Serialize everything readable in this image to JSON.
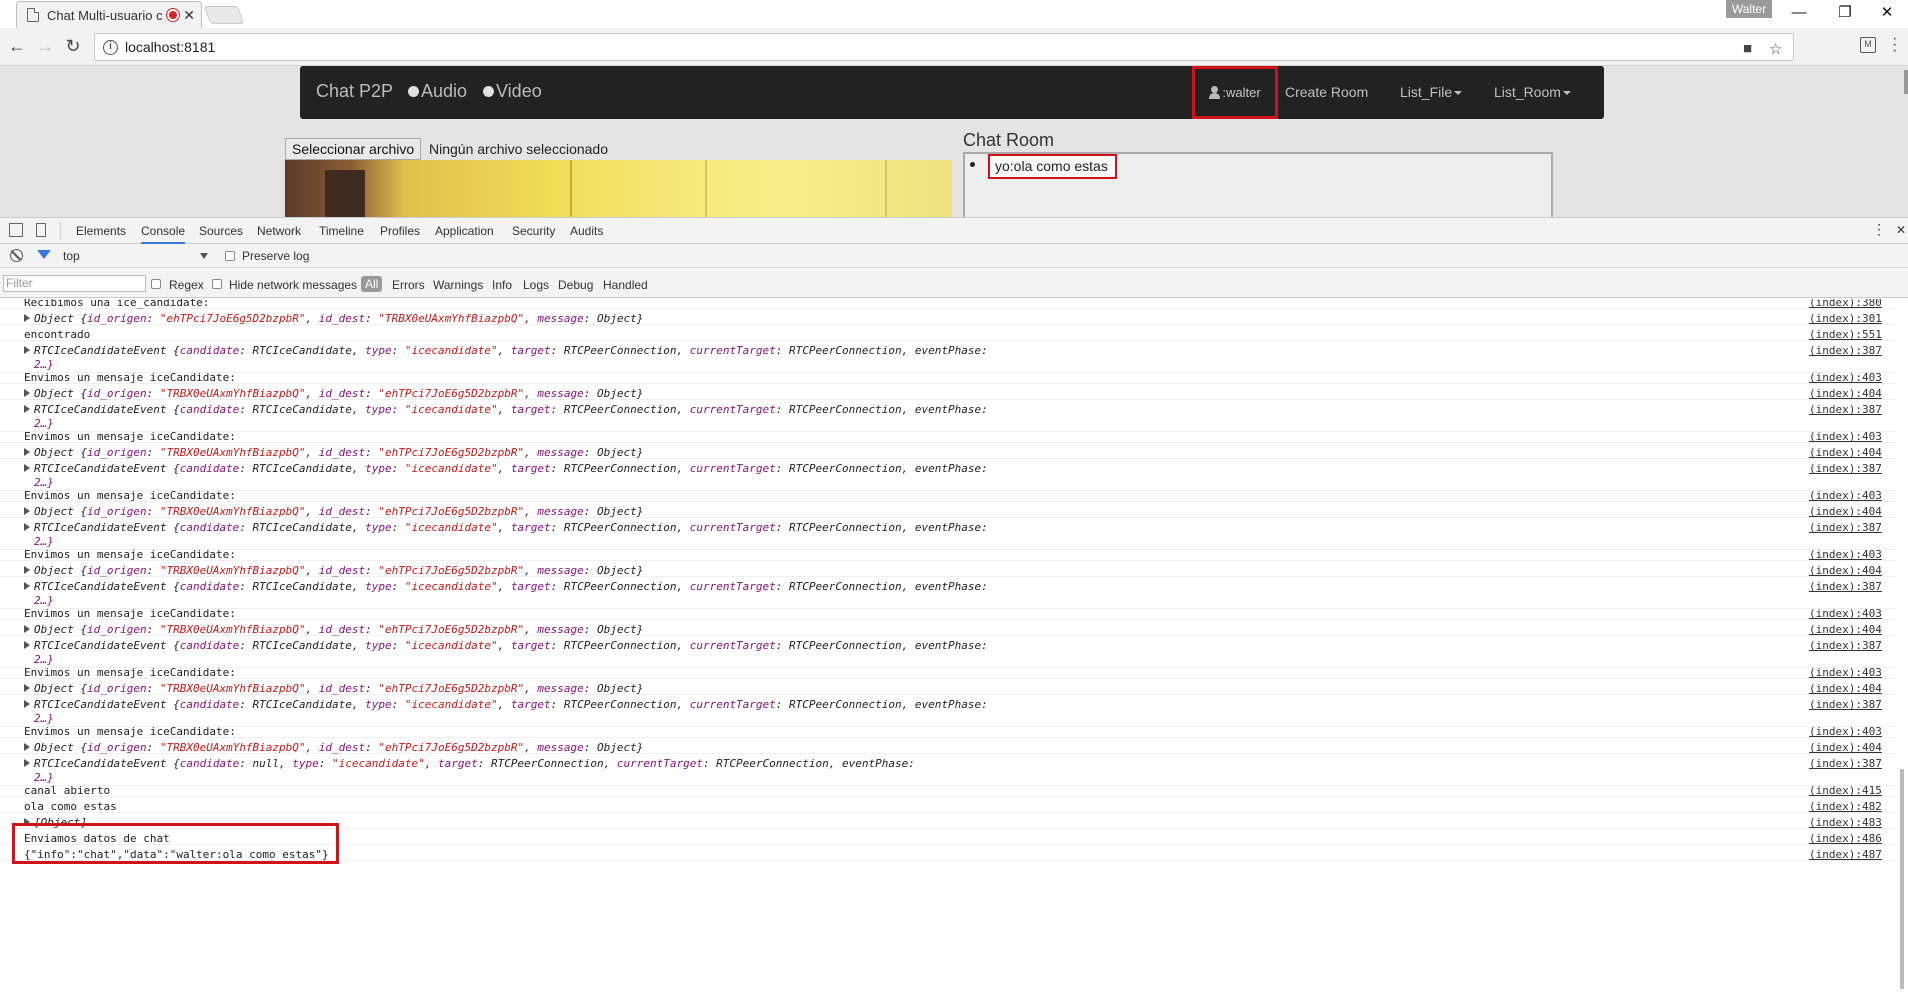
{
  "browser": {
    "tab_title": "Chat Multi-usuario co",
    "tab_close": "✕",
    "user_badge": "Walter",
    "win_minimize": "—",
    "win_restore": "❐",
    "win_close": "✕",
    "url": "localhost:8181",
    "back": "←",
    "forward": "→",
    "reload": "↻",
    "star": "☆",
    "camera": "■",
    "ext": "M"
  },
  "page": {
    "brand": "Chat P2P",
    "audio_label": "Audio",
    "video_label": "Video",
    "user_label": "walter",
    "create_room": "Create Room",
    "list_file": "List_File",
    "list_room": "List_Room",
    "file_button": "Seleccionar archivo",
    "file_status": "Ningún archivo seleccionado",
    "chat_title": "Chat Room",
    "chat_message": "yo:ola como estas"
  },
  "devtools": {
    "tabs": [
      "Elements",
      "Console",
      "Sources",
      "Network",
      "Timeline",
      "Profiles",
      "Application",
      "Security",
      "Audits"
    ],
    "active_tab": "Console",
    "context": "top",
    "preserve_log": "Preserve log",
    "filter_placeholder": "Filter",
    "regex": "Regex",
    "hide_network": "Hide network messages",
    "levels": [
      "All",
      "Errors",
      "Warnings",
      "Info",
      "Logs",
      "Debug",
      "Handled"
    ],
    "close": "✕"
  },
  "console_rows": [
    {
      "text": "Recibimos una ice_candidate:",
      "src": "(index):380",
      "kind": "text"
    },
    {
      "text": "Object {id_origen: \"ehTPci7JoE6g5D2bzpbR\", id_dest: \"TRBX0eUAxmYhfBiazpbQ\", message: Object}",
      "src": "(index):301",
      "kind": "obj"
    },
    {
      "text": "encontrado",
      "src": "(index):551",
      "kind": "text"
    },
    {
      "text": "RTCIceCandidateEvent {candidate: RTCIceCandidate, type: \"icecandidate\", target: RTCPeerConnection, currentTarget: RTCPeerConnection, eventPhase:",
      "cont": "2…}",
      "src": "(index):387",
      "kind": "evt"
    },
    {
      "text": "Envimos un mensaje iceCandidate:",
      "src": "(index):403",
      "kind": "text"
    },
    {
      "text": "Object {id_origen: \"TRBX0eUAxmYhfBiazpbQ\", id_dest: \"ehTPci7JoE6g5D2bzpbR\", message: Object}",
      "src": "(index):404",
      "kind": "obj"
    },
    {
      "text": "RTCIceCandidateEvent {candidate: RTCIceCandidate, type: \"icecandidate\", target: RTCPeerConnection, currentTarget: RTCPeerConnection, eventPhase:",
      "cont": "2…}",
      "src": "(index):387",
      "kind": "evt"
    },
    {
      "text": "Envimos un mensaje iceCandidate:",
      "src": "(index):403",
      "kind": "text"
    },
    {
      "text": "Object {id_origen: \"TRBX0eUAxmYhfBiazpbQ\", id_dest: \"ehTPci7JoE6g5D2bzpbR\", message: Object}",
      "src": "(index):404",
      "kind": "obj"
    },
    {
      "text": "RTCIceCandidateEvent {candidate: RTCIceCandidate, type: \"icecandidate\", target: RTCPeerConnection, currentTarget: RTCPeerConnection, eventPhase:",
      "cont": "2…}",
      "src": "(index):387",
      "kind": "evt"
    },
    {
      "text": "Envimos un mensaje iceCandidate:",
      "src": "(index):403",
      "kind": "text"
    },
    {
      "text": "Object {id_origen: \"TRBX0eUAxmYhfBiazpbQ\", id_dest: \"ehTPci7JoE6g5D2bzpbR\", message: Object}",
      "src": "(index):404",
      "kind": "obj"
    },
    {
      "text": "RTCIceCandidateEvent {candidate: RTCIceCandidate, type: \"icecandidate\", target: RTCPeerConnection, currentTarget: RTCPeerConnection, eventPhase:",
      "cont": "2…}",
      "src": "(index):387",
      "kind": "evt"
    },
    {
      "text": "Envimos un mensaje iceCandidate:",
      "src": "(index):403",
      "kind": "text"
    },
    {
      "text": "Object {id_origen: \"TRBX0eUAxmYhfBiazpbQ\", id_dest: \"ehTPci7JoE6g5D2bzpbR\", message: Object}",
      "src": "(index):404",
      "kind": "obj"
    },
    {
      "text": "RTCIceCandidateEvent {candidate: RTCIceCandidate, type: \"icecandidate\", target: RTCPeerConnection, currentTarget: RTCPeerConnection, eventPhase:",
      "cont": "2…}",
      "src": "(index):387",
      "kind": "evt"
    },
    {
      "text": "Envimos un mensaje iceCandidate:",
      "src": "(index):403",
      "kind": "text"
    },
    {
      "text": "Object {id_origen: \"TRBX0eUAxmYhfBiazpbQ\", id_dest: \"ehTPci7JoE6g5D2bzpbR\", message: Object}",
      "src": "(index):404",
      "kind": "obj"
    },
    {
      "text": "RTCIceCandidateEvent {candidate: RTCIceCandidate, type: \"icecandidate\", target: RTCPeerConnection, currentTarget: RTCPeerConnection, eventPhase:",
      "cont": "2…}",
      "src": "(index):387",
      "kind": "evt"
    },
    {
      "text": "Envimos un mensaje iceCandidate:",
      "src": "(index):403",
      "kind": "text"
    },
    {
      "text": "Object {id_origen: \"TRBX0eUAxmYhfBiazpbQ\", id_dest: \"ehTPci7JoE6g5D2bzpbR\", message: Object}",
      "src": "(index):404",
      "kind": "obj"
    },
    {
      "text": "RTCIceCandidateEvent {candidate: RTCIceCandidate, type: \"icecandidate\", target: RTCPeerConnection, currentTarget: RTCPeerConnection, eventPhase:",
      "cont": "2…}",
      "src": "(index):387",
      "kind": "evt"
    },
    {
      "text": "Envimos un mensaje iceCandidate:",
      "src": "(index):403",
      "kind": "text"
    },
    {
      "text": "Object {id_origen: \"TRBX0eUAxmYhfBiazpbQ\", id_dest: \"ehTPci7JoE6g5D2bzpbR\", message: Object}",
      "src": "(index):404",
      "kind": "obj"
    },
    {
      "text": "RTCIceCandidateEvent {candidate: null, type: \"icecandidate\", target: RTCPeerConnection, currentTarget: RTCPeerConnection, eventPhase:",
      "cont": "2…}",
      "src": "(index):387",
      "kind": "evt"
    },
    {
      "text": "canal abierto",
      "src": "(index):415",
      "kind": "text"
    },
    {
      "text": "ola como estas",
      "src": "(index):482",
      "kind": "text"
    },
    {
      "text": "[Object]",
      "src": "(index):483",
      "kind": "obj"
    },
    {
      "text": "Enviamos datos de chat",
      "src": "(index):486",
      "kind": "text"
    },
    {
      "text": "{\"info\":\"chat\",\"data\":\"walter:ola como estas\"}",
      "src": "(index):487",
      "kind": "text"
    }
  ]
}
